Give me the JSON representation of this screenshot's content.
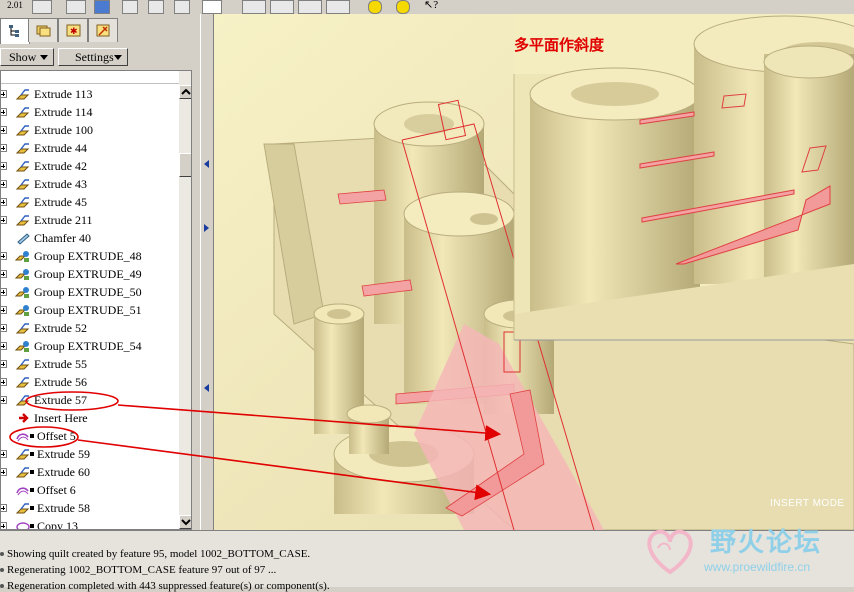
{
  "app": {
    "accent": "#ff0000",
    "viewport_bg": "#f4eec1"
  },
  "toolbar": {
    "icons": [
      "version-icon",
      "regen-icon",
      "cube-icon",
      "view-icon",
      "datum-icon",
      "smile-icon",
      "help-cursor-icon"
    ]
  },
  "panel": {
    "tabs": [
      {
        "name": "model-tree-tab",
        "icon": "tree-icon"
      },
      {
        "name": "folder-tab",
        "icon": "folder-icon"
      },
      {
        "name": "favorites-tab",
        "icon": "star-icon"
      },
      {
        "name": "tools-tab",
        "icon": "tools-icon"
      }
    ],
    "show_label": "Show",
    "settings_label": "Settings"
  },
  "tree": {
    "items": [
      {
        "label": "Extrude 113",
        "icon": "extrude-icon",
        "expandable": true
      },
      {
        "label": "Extrude 114",
        "icon": "extrude-icon",
        "expandable": true
      },
      {
        "label": "Extrude 100",
        "icon": "extrude-icon",
        "expandable": true
      },
      {
        "label": "Extrude 44",
        "icon": "extrude-icon",
        "expandable": true
      },
      {
        "label": "Extrude 42",
        "icon": "extrude-icon",
        "expandable": true
      },
      {
        "label": "Extrude 43",
        "icon": "extrude-icon",
        "expandable": true
      },
      {
        "label": "Extrude 45",
        "icon": "extrude-icon",
        "expandable": true
      },
      {
        "label": "Extrude 211",
        "icon": "extrude-icon",
        "expandable": true
      },
      {
        "label": "Chamfer 40",
        "icon": "chamfer-icon",
        "expandable": false
      },
      {
        "label": "Group EXTRUDE_48",
        "icon": "group-icon",
        "expandable": true
      },
      {
        "label": "Group EXTRUDE_49",
        "icon": "group-icon",
        "expandable": true
      },
      {
        "label": "Group EXTRUDE_50",
        "icon": "group-icon",
        "expandable": true
      },
      {
        "label": "Group EXTRUDE_51",
        "icon": "group-icon",
        "expandable": true
      },
      {
        "label": "Extrude 52",
        "icon": "extrude-icon",
        "expandable": true
      },
      {
        "label": "Group EXTRUDE_54",
        "icon": "group-icon",
        "expandable": true
      },
      {
        "label": "Extrude 55",
        "icon": "extrude-icon",
        "expandable": true
      },
      {
        "label": "Extrude 56",
        "icon": "extrude-icon",
        "expandable": true
      },
      {
        "label": "Extrude 57",
        "icon": "extrude-icon",
        "expandable": true
      },
      {
        "label": "Insert Here",
        "icon": "insert-arrow-icon",
        "expandable": false
      },
      {
        "label": "Offset 5",
        "icon": "offset-icon",
        "expandable": false,
        "suppressed": true
      },
      {
        "label": "Extrude 59",
        "icon": "extrude-icon",
        "expandable": true,
        "suppressed": true
      },
      {
        "label": "Extrude 60",
        "icon": "extrude-icon",
        "expandable": true,
        "suppressed": true
      },
      {
        "label": "Offset 6",
        "icon": "offset-icon",
        "expandable": false,
        "suppressed": true
      },
      {
        "label": "Extrude 58",
        "icon": "extrude-icon",
        "expandable": true,
        "suppressed": true
      },
      {
        "label": "Copy 13",
        "icon": "copy-icon",
        "expandable": true,
        "suppressed": true
      }
    ]
  },
  "viewport": {
    "annotation": "多平面作斜度",
    "mode_label": "INSERT MODE"
  },
  "messages": [
    "Showing quilt created by feature 95, model 1002_BOTTOM_CASE.",
    "Regenerating 1002_BOTTOM_CASE feature 97 out of 97 ...",
    "Regeneration completed with 443 suppressed feature(s) or component(s)."
  ],
  "watermark": {
    "title": "野火论坛",
    "url": "www.proewildfire.cn"
  }
}
